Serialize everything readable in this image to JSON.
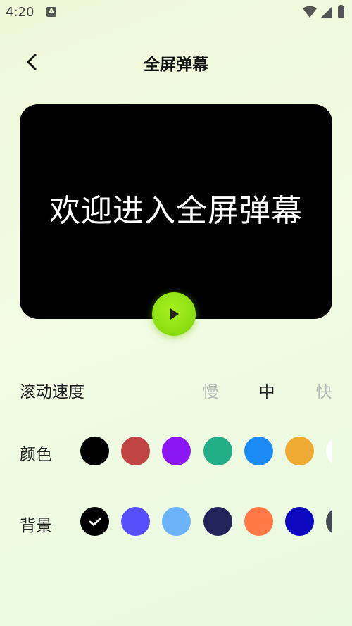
{
  "status_bar": {
    "time": "4:20",
    "notification_icon": "a-icon"
  },
  "header": {
    "title": "全屏弹幕",
    "back_icon": "back-arrow-icon"
  },
  "preview": {
    "text": "欢迎进入全屏弹幕",
    "play_icon": "play-icon"
  },
  "speed": {
    "label": "滚动速度",
    "options": [
      "慢",
      "中",
      "快"
    ],
    "selected": "中"
  },
  "color": {
    "label": "颜色",
    "swatches": [
      "#000000",
      "#c04444",
      "#8b17f5",
      "#22ae86",
      "#1b8af5",
      "#eeaa33",
      "#ffffff"
    ]
  },
  "background": {
    "label": "背景",
    "swatches": [
      "#000000",
      "#5750fa",
      "#6cb2f8",
      "#23255a",
      "#ff7a47",
      "#0b08c0",
      "#474c54"
    ],
    "selected_index": 0
  }
}
